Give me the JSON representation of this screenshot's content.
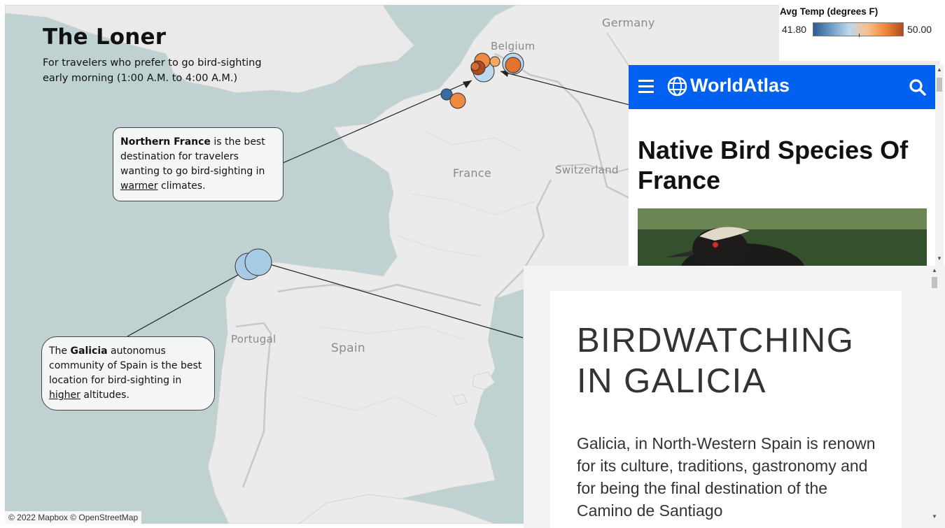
{
  "map": {
    "title": "The Loner",
    "subtitle": "For travelers who prefer to go bird-sighting early morning (1:00 A.M. to 4:00 A.M.)",
    "countries": {
      "germany": "Germany",
      "belgium": "Belgium",
      "france": "France",
      "switzerland": "Switzerland",
      "portugal": "Portugal",
      "spain": "Spain"
    },
    "callout_france": {
      "bold": "Northern France",
      "text1": " is the best destination for travelers wanting to go bird-sighting in ",
      "underline": "warmer",
      "text2": " climates."
    },
    "callout_galicia": {
      "text0": "The ",
      "bold": "Galicia",
      "text1": " autonomus community of Spain is the best location for bird-sighting in ",
      "underline": "higher",
      "text2": " altitudes."
    },
    "attribution": "© 2022 Mapbox © OpenStreetMap"
  },
  "legend": {
    "title": "Avg Temp (degrees F)",
    "min": "41.80",
    "max": "50.00",
    "colors": [
      "#2d5b94",
      "#bcd8ec",
      "#ee8a3f",
      "#b34a1e"
    ]
  },
  "worldatlas": {
    "brand": "WorldAtlas",
    "heading": "Native Bird Species Of France",
    "accent": "#0060f0",
    "icons": [
      "menu-icon",
      "globe-icon",
      "search-icon"
    ]
  },
  "galicia_page": {
    "heading_line1": "BIRDWATCHING",
    "heading_line2": "IN GALICIA",
    "paragraph": "Galicia, in North-Western Spain is renown for its culture, traditions, gastronomy and for being the final destination of the Camino de Santiago"
  }
}
